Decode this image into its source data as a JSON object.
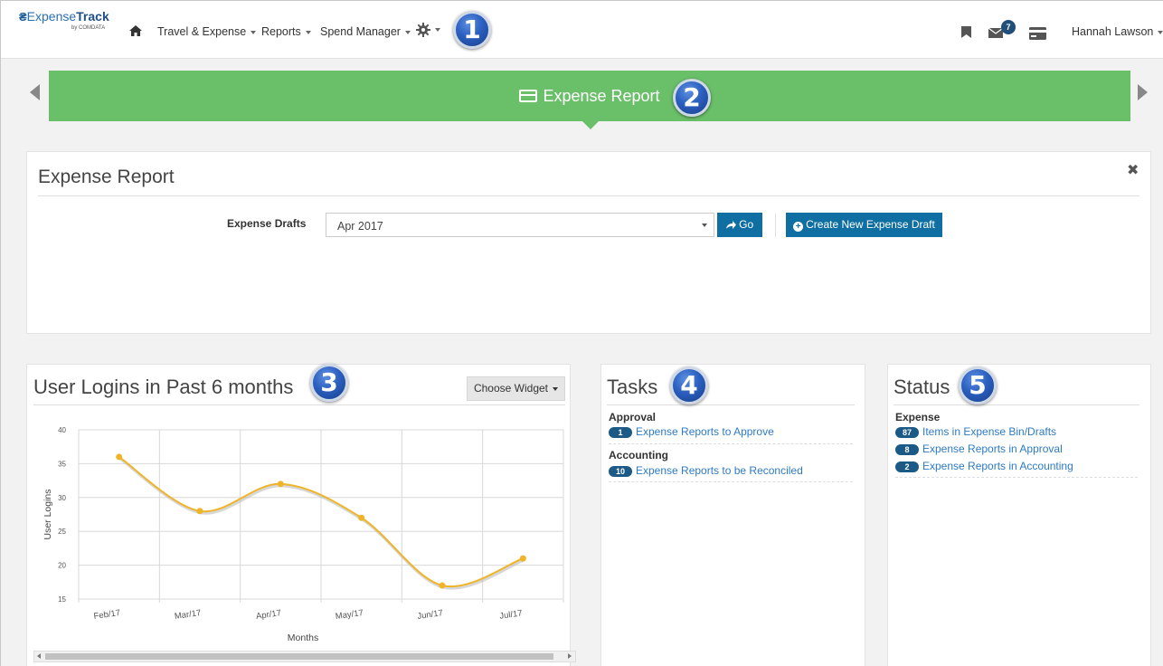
{
  "nav": {
    "logo_mark": "₴",
    "logo_brand_a": "Expense",
    "logo_brand_b": "Track",
    "logo_sub": "by COMDATA",
    "items": [
      "Travel & Expense",
      "Reports",
      "Spend Manager"
    ],
    "message_count": "7",
    "user_name": "Hannah Lawson"
  },
  "callouts": [
    "1",
    "2",
    "3",
    "4",
    "5"
  ],
  "banner": {
    "title": "Expense Report"
  },
  "expense_panel": {
    "title": "Expense Report",
    "close": "✖",
    "drafts_label": "Expense Drafts",
    "drafts_value": "Apr 2017",
    "go_label": "Go",
    "create_label": "Create New Expense Draft"
  },
  "chart_widget": {
    "title": "User Logins in Past 6 months",
    "choose_label": "Choose Widget"
  },
  "chart_data": {
    "type": "line",
    "categories": [
      "Feb/17",
      "Mar/17",
      "Apr/17",
      "May/17",
      "Jun/17",
      "Jul/17"
    ],
    "series": [
      {
        "values": [
          36,
          28,
          32,
          27,
          17,
          21
        ]
      }
    ],
    "xlabel": "Months",
    "ylabel": "User Logins",
    "ylim": [
      15,
      40
    ],
    "yticks": [
      15,
      20,
      25,
      30,
      35,
      40
    ],
    "grid": true,
    "colors": {
      "line": "#f0b429",
      "shadow": "#bdbdbd",
      "grid": "#d8d8d8"
    }
  },
  "tasks": {
    "title": "Tasks",
    "sections": [
      {
        "heading": "Approval",
        "items": [
          {
            "count": "1",
            "label": "Expense Reports to Approve"
          }
        ]
      },
      {
        "heading": "Accounting",
        "items": [
          {
            "count": "10",
            "label": "Expense Reports to be Reconciled"
          }
        ]
      }
    ]
  },
  "status": {
    "title": "Status",
    "heading": "Expense",
    "items": [
      {
        "count": "87",
        "label": "Items in Expense Bin/Drafts"
      },
      {
        "count": "8",
        "label": "Expense Reports in Approval"
      },
      {
        "count": "2",
        "label": "Expense Reports in Accounting"
      }
    ]
  },
  "colors": {
    "banner": "#6abf69",
    "primary_button": "#0f6fa3",
    "link": "#2d7bc4",
    "pill": "#1b5a86"
  }
}
